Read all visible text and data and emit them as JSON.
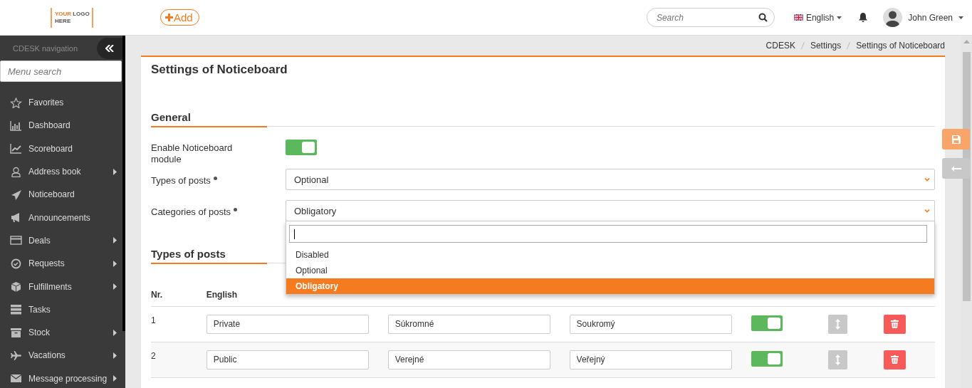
{
  "header": {
    "logo": {
      "line_1a": "YOUR",
      "line_1b": "LOGO",
      "line_2": "HERE"
    },
    "add_button": "Add",
    "search": {
      "placeholder": "Search"
    },
    "language": "English",
    "user": "John Green"
  },
  "sidebar": {
    "title": "CDESK navigation",
    "search": {
      "placeholder": "Menu search"
    },
    "items": [
      {
        "label": "Favorites",
        "submenu": false
      },
      {
        "label": "Dashboard",
        "submenu": false
      },
      {
        "label": "Scoreboard",
        "submenu": false
      },
      {
        "label": "Address book",
        "submenu": true
      },
      {
        "label": "Noticeboard",
        "submenu": false
      },
      {
        "label": "Announcements",
        "submenu": false
      },
      {
        "label": "Deals",
        "submenu": true
      },
      {
        "label": "Requests",
        "submenu": true
      },
      {
        "label": "Fulfillments",
        "submenu": true
      },
      {
        "label": "Tasks",
        "submenu": false
      },
      {
        "label": "Stock",
        "submenu": true
      },
      {
        "label": "Vacations",
        "submenu": true
      },
      {
        "label": "Message processing",
        "submenu": true
      }
    ]
  },
  "breadcrumb": [
    "CDESK",
    "Settings",
    "Settings of Noticeboard"
  ],
  "page_title": "Settings of Noticeboard",
  "general": {
    "title": "General",
    "fields": [
      {
        "kind": "toggle",
        "label": "Enable Noticeboard module",
        "required": false,
        "on": true
      },
      {
        "kind": "select",
        "label": "Types of posts",
        "required": true,
        "value": "Optional",
        "open": false
      },
      {
        "kind": "select",
        "label": "Categories of posts",
        "required": true,
        "value": "Obligatory",
        "open": true,
        "options": [
          {
            "label": "Disabled",
            "selected": false
          },
          {
            "label": "Optional",
            "selected": false
          },
          {
            "label": "Obligatory",
            "selected": true
          }
        ]
      }
    ]
  },
  "types_of_posts": {
    "title": "Types of posts",
    "columns": [
      "Nr.",
      "English"
    ],
    "rows": [
      {
        "nr": "1",
        "english": "Private",
        "slovak": "Súkromné",
        "czech": "Soukromý",
        "on": true
      },
      {
        "nr": "2",
        "english": "Public",
        "slovak": "Verejné",
        "czech": "Veřejný",
        "on": true
      }
    ]
  }
}
